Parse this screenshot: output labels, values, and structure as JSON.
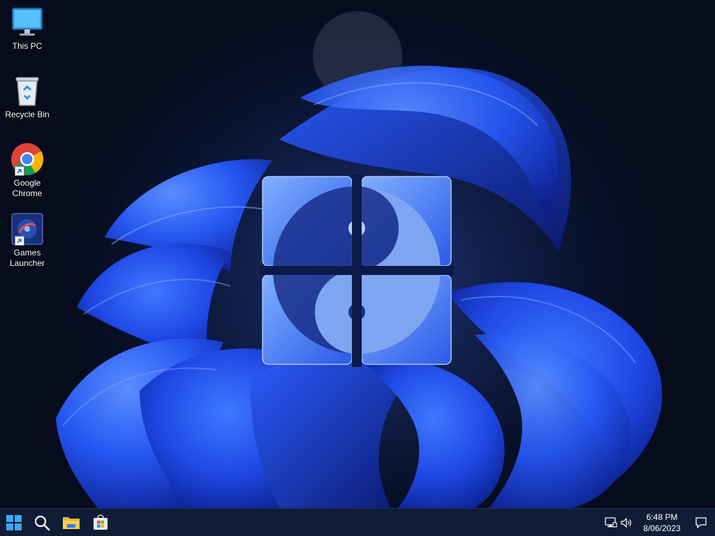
{
  "desktop": {
    "icons": [
      {
        "name": "this-pc",
        "label": "This PC",
        "icon": "monitor-icon",
        "shortcut": false
      },
      {
        "name": "recycle-bin",
        "label": "Recycle Bin",
        "icon": "recycle-bin-icon",
        "shortcut": false
      },
      {
        "name": "google-chrome",
        "label": "Google Chrome",
        "icon": "chrome-icon",
        "shortcut": true
      },
      {
        "name": "games-launcher",
        "label": "Games Launcher",
        "icon": "games-launcher-icon",
        "shortcut": true
      }
    ]
  },
  "taskbar": {
    "buttons": [
      {
        "name": "start",
        "icon": "windows-logo-icon"
      },
      {
        "name": "search",
        "icon": "search-icon"
      },
      {
        "name": "file-explorer",
        "icon": "folder-icon"
      },
      {
        "name": "microsoft-store",
        "icon": "store-icon"
      }
    ],
    "tray": {
      "network_icon": "network-icon",
      "volume_icon": "volume-icon",
      "notification_icon": "notification-icon"
    },
    "clock": {
      "time": "6:48 PM",
      "date": "8/06/2023"
    }
  },
  "colors": {
    "taskbar_bg": "#101c36",
    "wallpaper_accent": "#1e4bff",
    "logo_accent": "#3a6cf0"
  }
}
